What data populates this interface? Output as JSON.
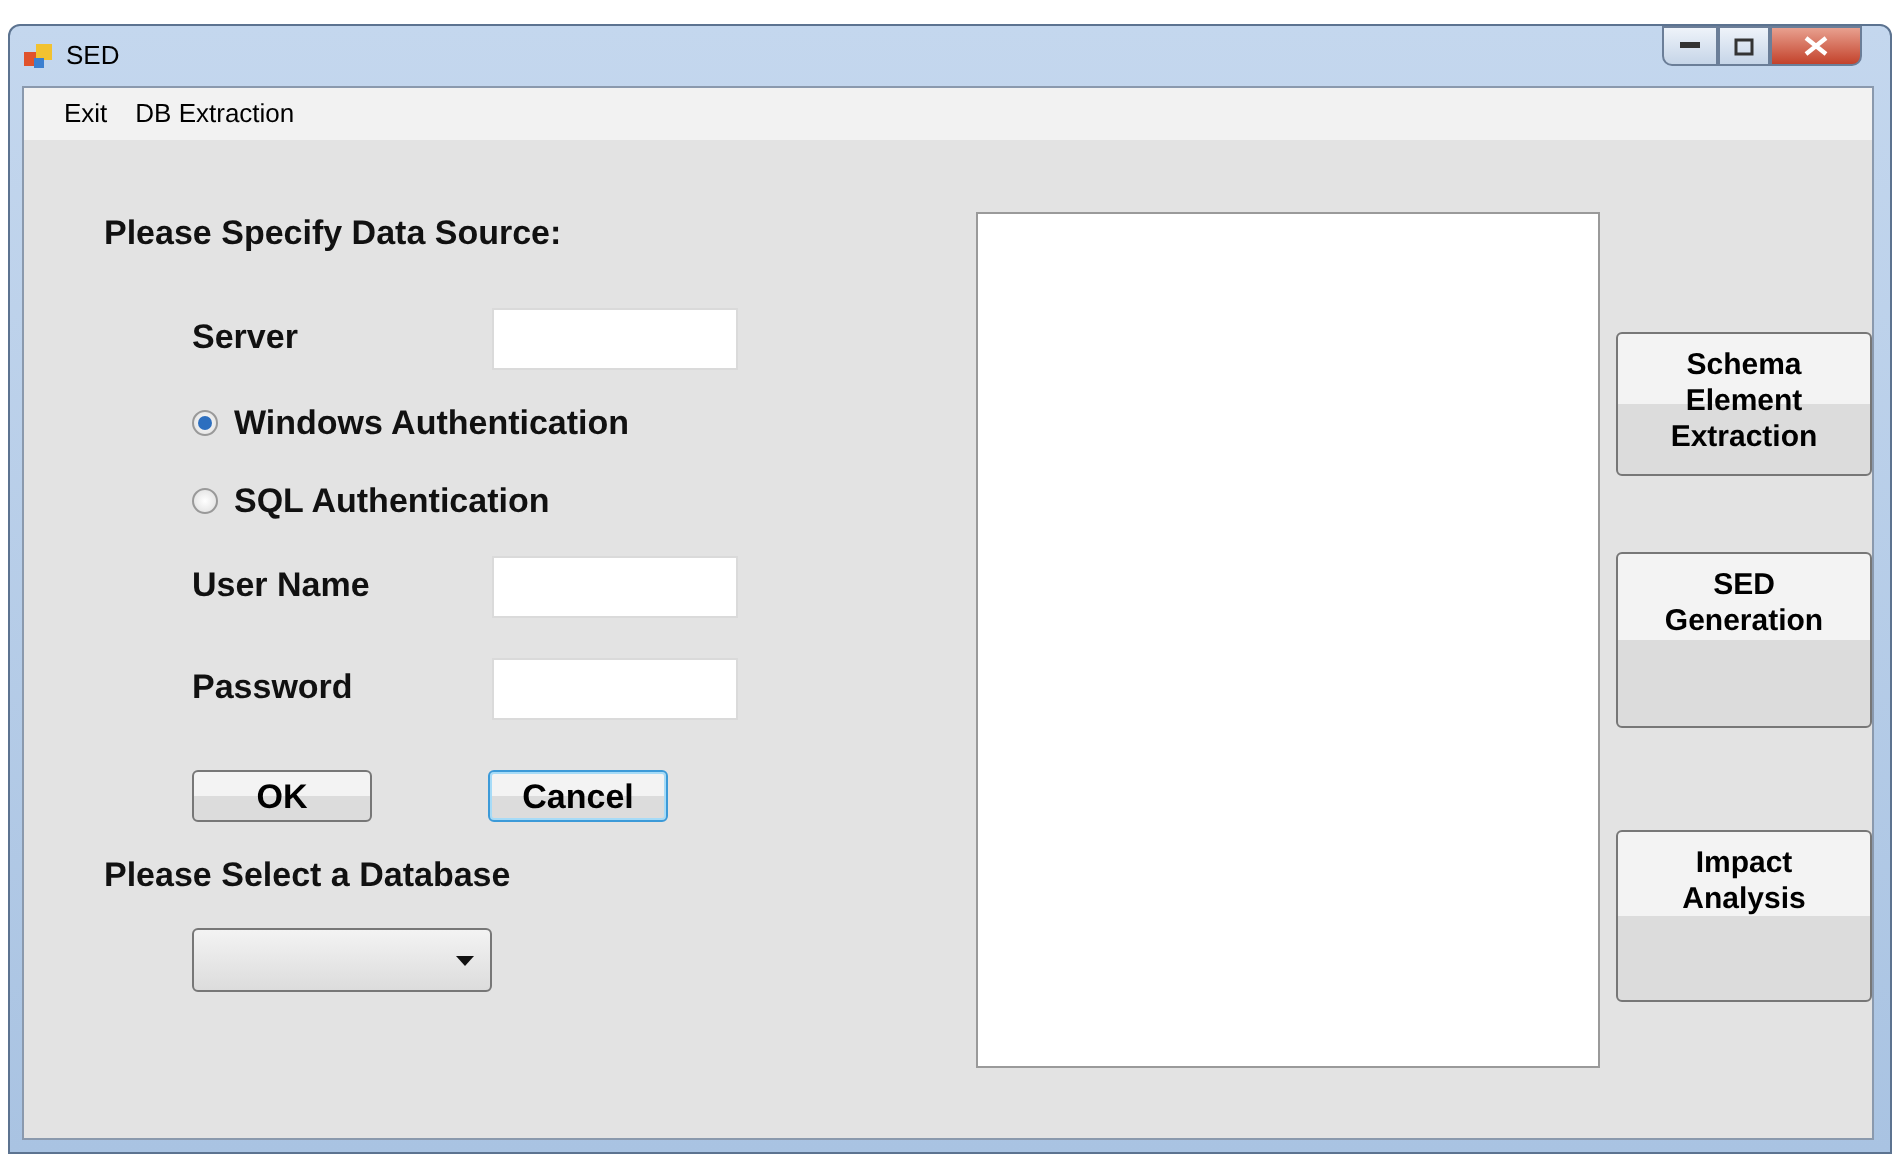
{
  "window": {
    "title": "SED"
  },
  "menu": [
    {
      "label": "Exit"
    },
    {
      "label": "DB Extraction"
    }
  ],
  "data_source": {
    "heading": "Please Specify Data Source:",
    "server": {
      "label": "Server"
    },
    "auth": [
      {
        "label": "Windows Authentication",
        "selected": true
      },
      {
        "label": "SQL Authentication",
        "selected": false
      }
    ],
    "user_name": {
      "label": "User Name"
    },
    "password": {
      "label": "Password"
    },
    "buttons": [
      {
        "label": "OK",
        "focused": false
      },
      {
        "label": "Cancel",
        "focused": true
      }
    ]
  },
  "database": {
    "heading": "Please Select a Database"
  },
  "actions": [
    {
      "label": "Schema Element Extraction"
    },
    {
      "label": "SED Generation"
    },
    {
      "label": "Impact Analysis"
    }
  ]
}
